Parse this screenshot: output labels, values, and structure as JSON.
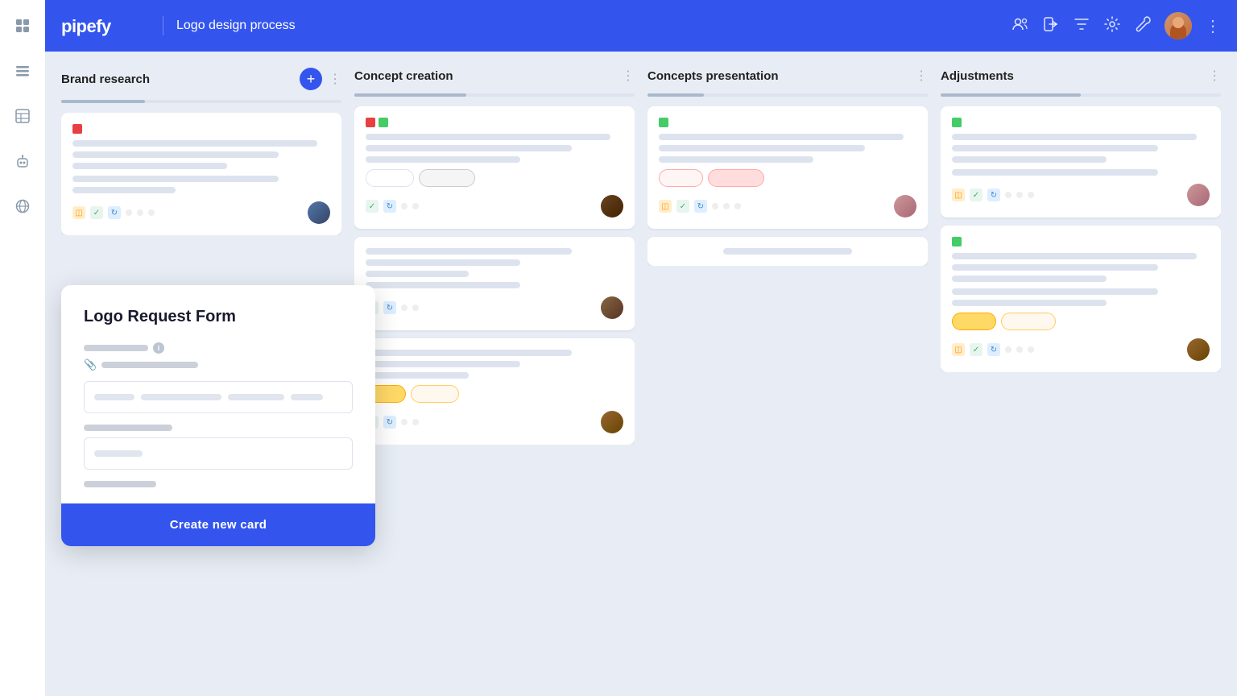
{
  "app": {
    "title": "Pipefy",
    "page_title": "Logo design process"
  },
  "sidebar": {
    "icons": [
      {
        "name": "grid-icon",
        "symbol": "⊞"
      },
      {
        "name": "list-icon",
        "symbol": "≡"
      },
      {
        "name": "table-icon",
        "symbol": "▦"
      },
      {
        "name": "bot-icon",
        "symbol": "⊙"
      },
      {
        "name": "globe-icon",
        "symbol": "⊕"
      }
    ]
  },
  "header": {
    "title": "Logo design process",
    "actions": [
      "users-icon",
      "signin-icon",
      "filter-icon",
      "settings-icon",
      "wrench-icon"
    ]
  },
  "columns": [
    {
      "id": "brand-research",
      "title": "Brand research",
      "show_add": true,
      "progress": 30,
      "cards": [
        {
          "tags": [
            "red"
          ],
          "lines": [
            "long",
            "medium",
            "short",
            "medium",
            "xshort",
            "short"
          ],
          "badges": [],
          "avatar": "av-male1",
          "icons": [
            "orange",
            "green",
            "blue",
            "dot",
            "dot",
            "dot"
          ]
        }
      ]
    },
    {
      "id": "concept-creation",
      "title": "Concept creation",
      "show_add": false,
      "progress": 40,
      "cards": [
        {
          "tags": [
            "red",
            "green"
          ],
          "lines": [
            "long",
            "medium",
            "short",
            "medium",
            "short"
          ],
          "badges": [
            "outline",
            "outline-gray"
          ],
          "avatar": "av-male2",
          "icons": [
            "green",
            "blue",
            "dot",
            "dot"
          ]
        },
        {
          "tags": [],
          "lines": [
            "medium",
            "short",
            "short",
            "xshort"
          ],
          "badges": [],
          "avatar": "av-male3",
          "icons": [
            "green",
            "blue",
            "dot",
            "dot"
          ]
        },
        {
          "tags": [],
          "lines": [
            "medium",
            "short",
            "xshort",
            "short"
          ],
          "badges": [
            "orange",
            "orange-outline"
          ],
          "avatar": "av-male4",
          "icons": [
            "green",
            "blue",
            "dot",
            "dot"
          ]
        }
      ]
    },
    {
      "id": "concepts-presentation",
      "title": "Concepts presentation",
      "show_add": false,
      "progress": 20,
      "cards": [
        {
          "tags": [
            "green"
          ],
          "lines": [
            "long",
            "medium",
            "short",
            "medium"
          ],
          "badges": [
            "outline-pink",
            "outline-pink-filled"
          ],
          "avatar": "av-female1",
          "icons": [
            "orange",
            "green",
            "blue",
            "dot",
            "dot",
            "dot"
          ]
        },
        {
          "tags": [],
          "lines": [
            "medium"
          ],
          "badges": [],
          "avatar": null,
          "icons": []
        }
      ]
    },
    {
      "id": "adjustments",
      "title": "Adjustments",
      "show_add": false,
      "progress": 50,
      "cards": [
        {
          "tags": [
            "green"
          ],
          "lines": [
            "long",
            "medium",
            "short",
            "medium"
          ],
          "badges": [],
          "avatar": "av-female1",
          "icons": [
            "orange",
            "green",
            "blue",
            "dot",
            "dot",
            "dot"
          ]
        },
        {
          "tags": [
            "green"
          ],
          "lines": [
            "long",
            "medium",
            "short",
            "medium",
            "short"
          ],
          "badges": [
            "orange-filled",
            "orange-outline"
          ],
          "avatar": "av-male4",
          "icons": [
            "orange",
            "green",
            "blue",
            "dot",
            "dot",
            "dot"
          ]
        }
      ]
    }
  ],
  "modal": {
    "title": "Logo Request Form",
    "fields": [
      {
        "type": "text",
        "label_width": 80,
        "has_info": true,
        "has_attach": true,
        "input_bars": [
          50,
          100,
          60,
          40
        ]
      },
      {
        "type": "text",
        "label_width": 110,
        "has_info": false,
        "has_attach": false,
        "input_bars": [
          40
        ]
      }
    ],
    "bottom_label_width": 90,
    "submit_button": "Create new card"
  }
}
